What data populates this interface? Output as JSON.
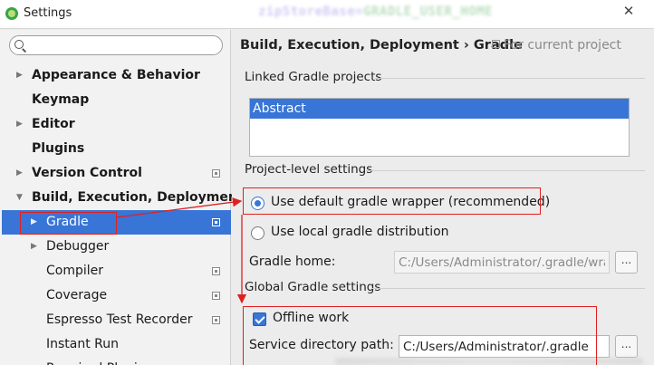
{
  "window": {
    "title": "Settings",
    "blurred_title_fragment_a": "zipStoreBase=",
    "blurred_title_fragment_b": "GRADLE_USER_HOME",
    "close_glyph": "✕"
  },
  "search": {
    "placeholder": "",
    "value": ""
  },
  "sidebar": {
    "items": [
      {
        "label": "Appearance & Behavior",
        "arrow": "▶",
        "project_icon": false
      },
      {
        "label": "Keymap",
        "arrow": "",
        "project_icon": false
      },
      {
        "label": "Editor",
        "arrow": "▶",
        "project_icon": false
      },
      {
        "label": "Plugins",
        "arrow": "",
        "project_icon": false
      },
      {
        "label": "Version Control",
        "arrow": "▶",
        "project_icon": true
      },
      {
        "label": "Build, Execution, Deployment",
        "arrow": "▼",
        "project_icon": false
      },
      {
        "label": "Gradle",
        "arrow": "▶",
        "project_icon": true,
        "selected": true
      },
      {
        "label": "Debugger",
        "arrow": "▶",
        "project_icon": false
      },
      {
        "label": "Compiler",
        "arrow": "",
        "project_icon": true
      },
      {
        "label": "Coverage",
        "arrow": "",
        "project_icon": true
      },
      {
        "label": "Espresso Test Recorder",
        "arrow": "",
        "project_icon": true
      },
      {
        "label": "Instant Run",
        "arrow": "",
        "project_icon": false
      },
      {
        "label": "Required Plugins",
        "arrow": "",
        "project_icon": true
      }
    ]
  },
  "header": {
    "breadcrumb": "Build, Execution, Deployment › Gradle",
    "scope": "For current project"
  },
  "linked_projects": {
    "title": "Linked Gradle projects",
    "items": [
      "Abstract"
    ]
  },
  "project_level": {
    "title": "Project-level settings",
    "option_wrapper": "Use default gradle wrapper (recommended)",
    "option_local": "Use local gradle distribution",
    "selected": "wrapper",
    "gradle_home_label": "Gradle home:",
    "gradle_home_value": "C:/Users/Administrator/.gradle/wrapper",
    "browse": "..."
  },
  "global": {
    "title": "Global Gradle settings",
    "offline_label": "Offline work",
    "offline_checked": true,
    "service_dir_label": "Service directory path:",
    "service_dir_value": "C:/Users/Administrator/.gradle",
    "browse": "..."
  },
  "colors": {
    "selection": "#3875d7",
    "annotation": "#e02020"
  }
}
